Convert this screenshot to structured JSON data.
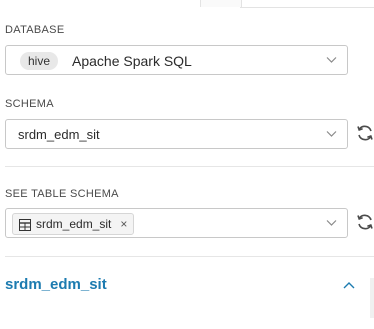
{
  "database": {
    "label": "DATABASE",
    "badge": "hive",
    "value": "Apache Spark SQL"
  },
  "schema": {
    "label": "SCHEMA",
    "value": "srdm_edm_sit"
  },
  "see_table_schema": {
    "label": "SEE TABLE SCHEMA",
    "tag_value": "srdm_edm_sit",
    "remove_glyph": "×"
  },
  "section": {
    "title": "srdm_edm_sit"
  },
  "icons": {
    "dropdown": "chevron-down-icon",
    "refresh": "refresh-icon",
    "table": "table-icon",
    "collapse": "chevron-up-icon"
  },
  "colors": {
    "accent": "#1c7bb0",
    "border": "#c8c8c8"
  }
}
